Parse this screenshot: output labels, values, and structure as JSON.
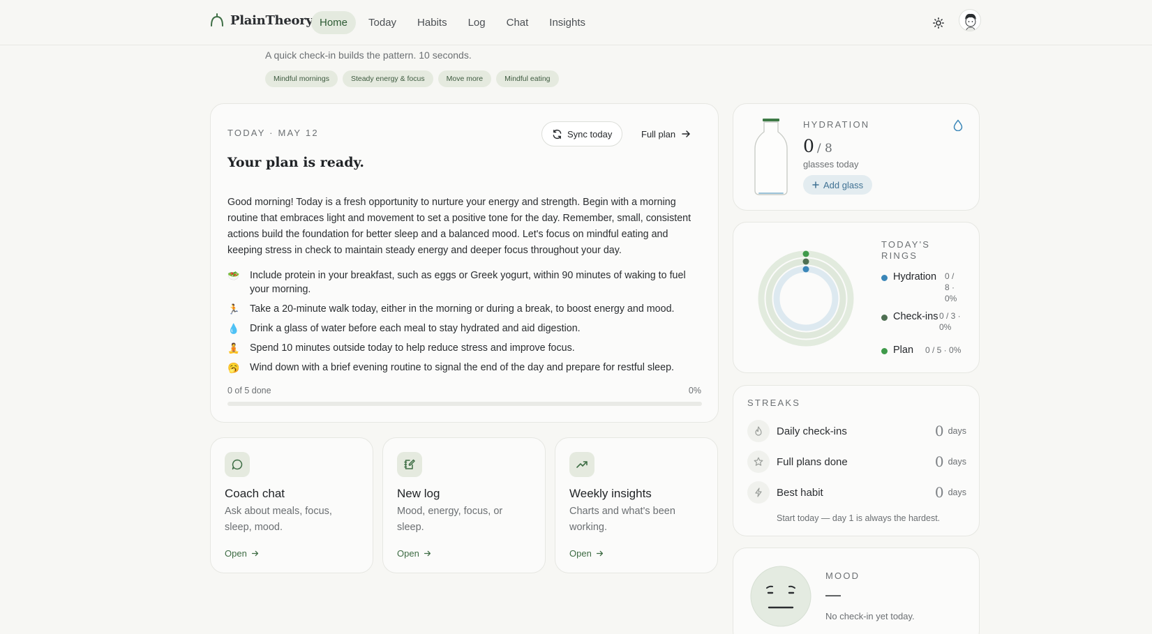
{
  "brand": {
    "name": "PlainTheory"
  },
  "nav": {
    "items": [
      {
        "label": "Home",
        "active": true
      },
      {
        "label": "Today",
        "active": false
      },
      {
        "label": "Habits",
        "active": false
      },
      {
        "label": "Log",
        "active": false
      },
      {
        "label": "Chat",
        "active": false
      },
      {
        "label": "Insights",
        "active": false
      }
    ],
    "theme_icon": "sun-icon",
    "avatar_icon": "avatar-illustration"
  },
  "header": {
    "subtitle": "A quick check-in builds the pattern. 10 seconds.",
    "chips": [
      "Mindful mornings",
      "Steady energy & focus",
      "Move more",
      "Mindful eating"
    ]
  },
  "plan": {
    "date": "TODAY · MAY 12",
    "sync_label": "Sync today",
    "full_plan_label": "Full plan",
    "title": "Your plan is ready.",
    "body": "Good morning! Today is a fresh opportunity to nurture your energy and strength. Begin with a morning routine that embraces light and movement to set a positive tone for the day. Remember, small, consistent actions build the foundation for better sleep and a balanced mood. Let's focus on mindful eating and keeping stress in check to maintain steady energy and deeper focus throughout your day.",
    "items": [
      {
        "emoji": "🥗",
        "text": "Include protein in your breakfast, such as eggs or Greek yogurt, within 90 minutes of waking to fuel your morning."
      },
      {
        "emoji": "🏃",
        "text": "Take a 20-minute walk today, either in the morning or during a break, to boost energy and mood."
      },
      {
        "emoji": "💧",
        "text": "Drink a glass of water before each meal to stay hydrated and aid digestion."
      },
      {
        "emoji": "🧘",
        "text": "Spend 10 minutes outside today to help reduce stress and improve focus."
      },
      {
        "emoji": "🥱",
        "text": "Wind down with a brief evening routine to signal the end of the day and prepare for restful sleep."
      }
    ],
    "progress_label": "0 of 5 done",
    "progress_pct": "0%",
    "progress_fraction": 0
  },
  "shortcuts": [
    {
      "title": "Coach chat",
      "desc": "Ask about meals, focus, sleep, mood.",
      "open": "Open",
      "icon": "chat-bubble-icon"
    },
    {
      "title": "New log",
      "desc": "Mood, energy, focus, or sleep.",
      "open": "Open",
      "icon": "notebook-pen-icon"
    },
    {
      "title": "Weekly insights",
      "desc": "Charts and what's been working.",
      "open": "Open",
      "icon": "trending-up-icon"
    }
  ],
  "hydration": {
    "eyebrow": "HYDRATION",
    "count": "0",
    "of": "/ 8",
    "caption": "glasses today",
    "add_label": "Add glass",
    "fill_fraction": 0,
    "accent": "#3f7193"
  },
  "rings": {
    "eyebrow": "TODAY'S RINGS",
    "legend": [
      {
        "name": "Hydration",
        "value": "0 / 8 · 0%",
        "color": "#3a86b8",
        "fraction": 0
      },
      {
        "name": "Check-ins",
        "value": "0 / 3 · 0%",
        "color": "#4e6f52",
        "fraction": 0
      },
      {
        "name": "Plan",
        "value": "0 / 5 · 0%",
        "color": "#3f9a4a",
        "fraction": 0
      }
    ]
  },
  "streaks": {
    "eyebrow": "STREAKS",
    "rows": [
      {
        "name": "Daily check-ins",
        "value": "0",
        "unit": "days",
        "icon": "flame-icon"
      },
      {
        "name": "Full plans done",
        "value": "0",
        "unit": "days",
        "icon": "star-icon"
      },
      {
        "name": "Best habit",
        "value": "0",
        "unit": "days",
        "icon": "bolt-icon"
      }
    ],
    "note": "Start today — day 1 is always the hardest."
  },
  "mood": {
    "eyebrow": "MOOD",
    "value": "—",
    "caption": "No check-in yet today."
  }
}
